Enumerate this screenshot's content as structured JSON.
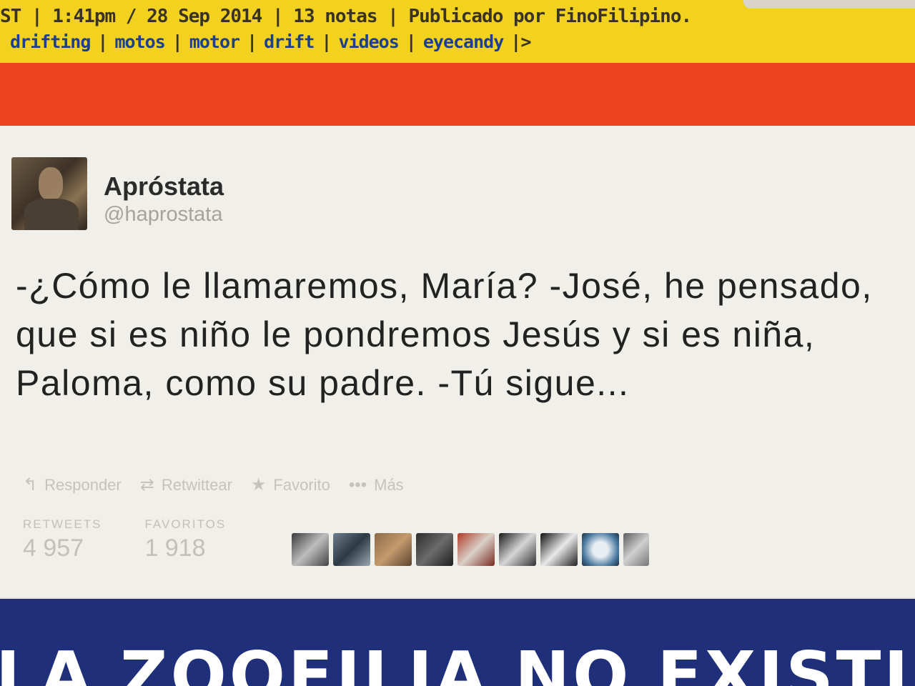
{
  "post_meta": {
    "line1": "ST | 1:41pm / 28 Sep 2014 | 13 notas | Publicado por FinoFilipino.",
    "tags": [
      "drifting",
      "motos",
      "motor",
      "drift",
      "videos",
      "eyecandy"
    ],
    "tags_end": "|>"
  },
  "tweet": {
    "display_name": "Apróstata",
    "handle": "@haprostata",
    "text": "-¿Cómo le llamaremos, María? -José, he pensado, que si es niño le pondremos Jesús y si es niña, Paloma, como su padre. -Tú sigue...",
    "actions": [
      {
        "icon": "reply-icon",
        "glyph": "↰",
        "label": "Responder"
      },
      {
        "icon": "retweet-icon",
        "glyph": "⇄",
        "label": "Retwittear"
      },
      {
        "icon": "star-icon",
        "glyph": "★",
        "label": "Favorito"
      },
      {
        "icon": "more-icon",
        "glyph": "•••",
        "label": "Más"
      }
    ],
    "stats": {
      "retweets_label": "RETWEETS",
      "retweets_value": "4 957",
      "favorites_label": "FAVORITOS",
      "favorites_value": "1 918"
    }
  },
  "banner": {
    "text": "LA ZOOFILIA NO EXISTIRÍA"
  },
  "colors": {
    "meta_yellow": "#f3d21f",
    "red_band": "#ee4221",
    "banner_blue": "#1f2f7a",
    "tag_blue": "#1d3f8f"
  }
}
